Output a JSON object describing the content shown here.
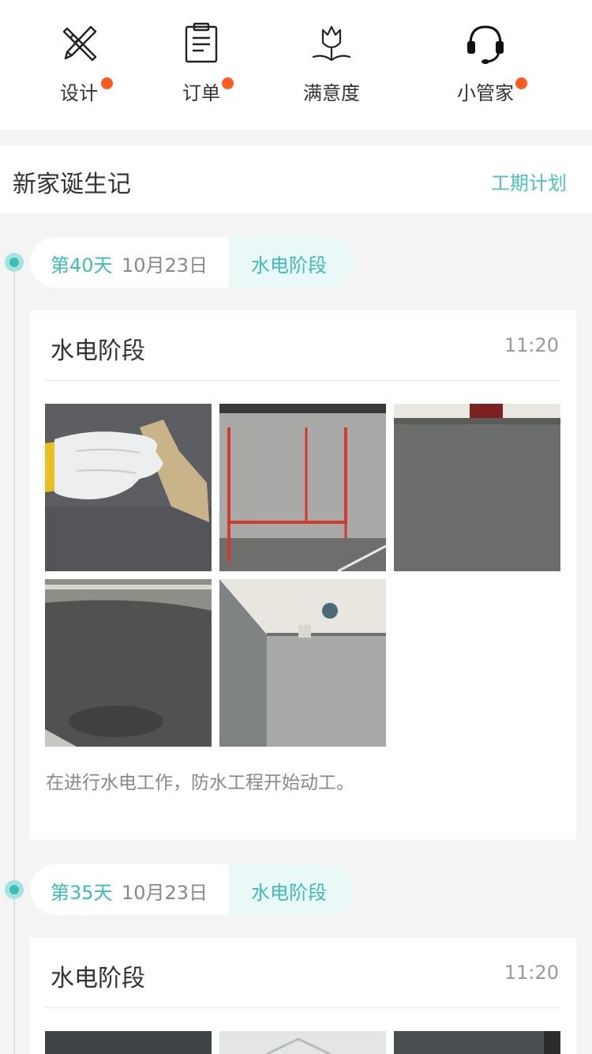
{
  "nav": [
    {
      "label": "设计",
      "icon": "design-tools-icon",
      "badge": true
    },
    {
      "label": "订单",
      "icon": "order-clipboard-icon",
      "badge": true
    },
    {
      "label": "满意度",
      "icon": "satisfaction-flower-icon",
      "badge": false
    },
    {
      "label": "小管家",
      "icon": "headset-icon",
      "badge": true
    }
  ],
  "section": {
    "title": "新家诞生记",
    "link": "工期计划"
  },
  "timeline": [
    {
      "day": "第40天",
      "date": "10月23日",
      "stage": "水电阶段",
      "card": {
        "title": "水电阶段",
        "time": "11:20",
        "description": "在进行水电工作，防水工程开始动工。"
      }
    },
    {
      "day": "第35天",
      "date": "10月23日",
      "stage": "水电阶段",
      "card": {
        "title": "水电阶段",
        "time": "11:20"
      }
    }
  ],
  "colors": {
    "accent": "#3cbdb6",
    "badge": "#ff5a1f",
    "background": "#f4f4f4"
  }
}
